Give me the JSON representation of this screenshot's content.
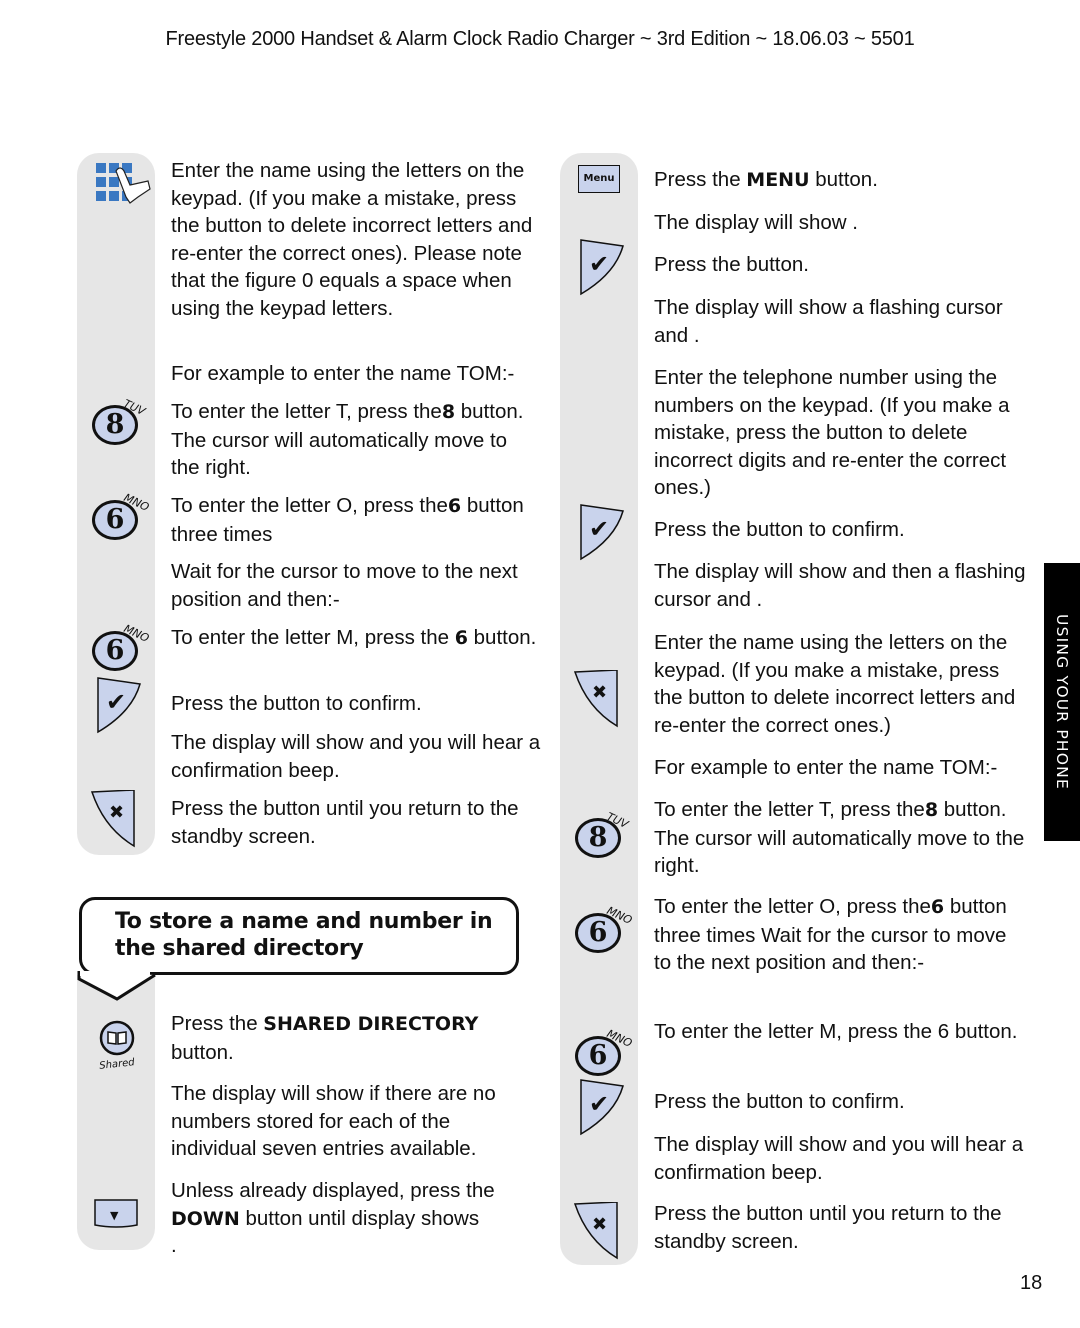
{
  "header": {
    "title": "Freestyle 2000 Handset & Alarm Clock Radio Charger  ~ 3rd Edition ~ 18.06.03 ~ 5501"
  },
  "left_column": {
    "steps": [
      {
        "text": "Enter the name using the letters on the keypad. (If you make a mistake, press the     button to delete incorrect letters and re-enter the correct ones). Please note that the figure 0 equals a space when using the keypad letters."
      },
      {
        "text": "For example to enter the name TOM:-"
      },
      {
        "text_pre": "To enter the letter T, press the",
        "bold": "8",
        "text_post": " button. The cursor will automatically move to the right."
      },
      {
        "text_pre": "To enter the letter O, press the",
        "bold": "6",
        "text_post": " button three times"
      },
      {
        "text": "Wait for the cursor to move to the next position and then:-"
      },
      {
        "text_pre": "To enter the letter M, press the ",
        "bold": "6",
        "text_post": " button."
      },
      {
        "text": "Press the      button to confirm."
      },
      {
        "text": "The display will show                  and you will hear a confirmation beep."
      },
      {
        "text": "Press the     button until you return to the standby screen."
      }
    ],
    "section_heading": "To store a name and number in the shared directory",
    "section_steps": [
      {
        "text_pre": "Press the ",
        "bold": "SHARED DIRECTORY",
        "text_post": " button."
      },
      {
        "text": "The display will show              if there are no numbers stored for each of the individual seven entries available."
      },
      {
        "text_pre": "Unless already displayed, press the ",
        "bold": "DOWN",
        "text_post": " button until display shows"
      },
      {
        "text": "          ."
      }
    ]
  },
  "right_column": {
    "steps": [
      {
        "text_pre": "Press the ",
        "bold": "MENU",
        "text_post": " button."
      },
      {
        "text": "The display will show                ."
      },
      {
        "text": "Press the      button."
      },
      {
        "text": "The display will show a flashing cursor and               ."
      },
      {
        "text": "Enter the telephone number using the numbers on the keypad. (If you make a mistake, press the button to delete incorrect digits and re-enter the correct ones.)"
      },
      {
        "text": "Press the      button to confirm."
      },
      {
        "text": "The display will show                and then a flashing cursor and          ."
      },
      {
        "text": "Enter the name using the letters on the keypad. (If you make a mistake, press the     button to delete incorrect letters and re-enter the correct ones.)"
      },
      {
        "text": "For example to enter the name TOM:-"
      },
      {
        "text_pre": "To enter the letter T, press the",
        "bold": "8",
        "text_post": " button. The cursor will automatically move to the right."
      },
      {
        "text_pre": "To enter the letter O, press the",
        "bold": "6",
        "text_post": " button three times Wait for the cursor to move to the next position and then:-"
      },
      {
        "text": "To enter the letter M, press the 6 button."
      },
      {
        "text": "Press the      button to confirm."
      },
      {
        "text": "The display will show                  and you will hear a confirmation beep."
      },
      {
        "text": "Press the     button until you return to the standby screen."
      }
    ]
  },
  "icons": {
    "menu_label": "Menu",
    "shared_label": "Shared",
    "key8": {
      "digit": "8",
      "letters": "TUV"
    },
    "key6": {
      "digit": "6",
      "letters": "MNO"
    },
    "check_glyph": "✔",
    "cancel_glyph": "✖",
    "down_glyph": "▼"
  },
  "side_tab": {
    "label": "USING YOUR PHONE"
  },
  "page_number": "18",
  "colors": {
    "icon_fill": "#c9d3ec",
    "keypad_blue": "#3a78c2",
    "rail_grey": "#e6e6e6",
    "tab_black": "#000000"
  }
}
